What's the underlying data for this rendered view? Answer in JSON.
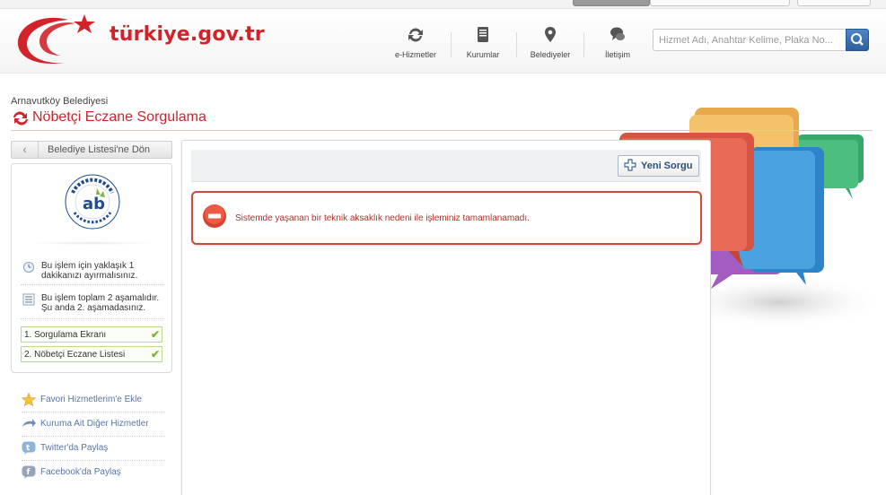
{
  "header": {
    "site_name": "türkiye.gov.tr",
    "nav": [
      {
        "label": "e-Hizmetler",
        "icon": "refresh-icon"
      },
      {
        "label": "Kurumlar",
        "icon": "book-icon"
      },
      {
        "label": "Belediyeler",
        "icon": "map-pin-icon"
      },
      {
        "label": "İletişim",
        "icon": "chat-icon"
      }
    ],
    "search_placeholder": "Hizmet Adı, Anahtar Kelime, Plaka No..."
  },
  "page": {
    "municipality": "Arnavutköy Belediyesi",
    "title": "Nöbetçi Eczane Sorgulama"
  },
  "sidebar": {
    "back_label": "Belediye Listesi'ne Dön",
    "info_time": "Bu işlem için yaklaşık 1 dakikanızı ayırmalısınız.",
    "info_steps": "Bu işlem toplam 2 aşamalıdır. Şu anda 2. aşamadasınız.",
    "steps": [
      {
        "label": "1. Sorgulama Ekranı",
        "done": true
      },
      {
        "label": "2. Nöbetçi Eczane Listesi",
        "done": true
      }
    ],
    "links": [
      {
        "label": "Favori Hizmetlerim'e Ekle",
        "icon": "star-icon"
      },
      {
        "label": "Kuruma Ait Diğer Hizmetler",
        "icon": "arrow-icon"
      },
      {
        "label": "Twitter'da Paylaş",
        "icon": "twitter-icon"
      },
      {
        "label": "Facebook'da Paylaş",
        "icon": "facebook-icon"
      }
    ]
  },
  "main": {
    "new_query_label": "Yeni Sorgu",
    "error_message": "Sistemde yaşanan bir teknik aksaklık nedeni ile işleminiz tamamlanamadı."
  },
  "colors": {
    "brand_red": "#d2232a",
    "link_blue": "#5875a3",
    "step_green": "#79b838"
  }
}
